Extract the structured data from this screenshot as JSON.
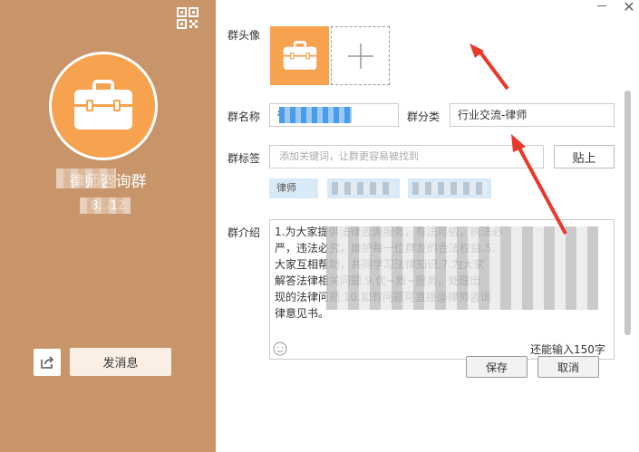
{
  "left": {
    "group_name": "律师咨询群",
    "group_id": "8…12",
    "send_message": "发消息"
  },
  "form": {
    "avatar_label": "群头像",
    "name_label": "群名称",
    "name_value": "律师咨询群",
    "category_label": "群分类",
    "category_value": "行业交流-律师",
    "tags_label": "群标签",
    "tags_placeholder": "添加关键词，让群更容易被找到",
    "paste_label": "贴上",
    "tags": [
      "律师",
      "律师咨询",
      "法律咨询"
    ],
    "intro_label": "群介绍",
    "intro_lines": [
      "1.为大家提供法律咨询服务，有法可依，执法必",
      "严，违法必究，维护每一位群友的合法权益.5.",
      "大家互相帮助，共同学习法律知识.7.为大家",
      "解答法律相关问题.9.优~质~服务，处理出",
      "现的法律问题.10.如有问题可直接@律师咨询",
      "律意见书。"
    ],
    "remaining": "还能输入150字",
    "save": "保存",
    "cancel": "取消"
  },
  "colors": {
    "left_bg": "#c8956a",
    "avatar": "#f7a24f",
    "arrow": "#e8392b"
  },
  "icons": [
    "qr-code-icon",
    "briefcase-icon",
    "plus-icon",
    "share-icon",
    "emoji-icon",
    "close-icon",
    "minimize-icon"
  ]
}
